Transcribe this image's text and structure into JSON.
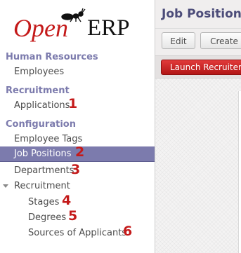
{
  "logo": {
    "text_open": "Open",
    "text_erp": "ERP"
  },
  "sidebar": {
    "sections": [
      {
        "title": "Human Resources"
      },
      {
        "title": "Recruitment"
      },
      {
        "title": "Configuration"
      }
    ],
    "items": [
      {
        "label": "Employees",
        "number": ""
      },
      {
        "label": "Applications",
        "number": "1"
      },
      {
        "label": "Employee Tags",
        "number": ""
      },
      {
        "label": "Job Positions",
        "number": "2"
      },
      {
        "label": "Departments",
        "number": "3"
      },
      {
        "label": "Recruitment",
        "number": ""
      },
      {
        "label": "Stages",
        "number": "4"
      },
      {
        "label": "Degrees",
        "number": "5"
      },
      {
        "label": "Sources of Applicants",
        "number": "6"
      }
    ]
  },
  "main": {
    "title": "Job Positions",
    "edit_label": "Edit",
    "create_label": "Create",
    "launch_label": "Launch Recruitement"
  },
  "colors": {
    "section_title": "#7c7bad",
    "active_item": "#7c7bad",
    "annotation_number": "#c41a1a",
    "launch_button": "#c41a1a"
  }
}
